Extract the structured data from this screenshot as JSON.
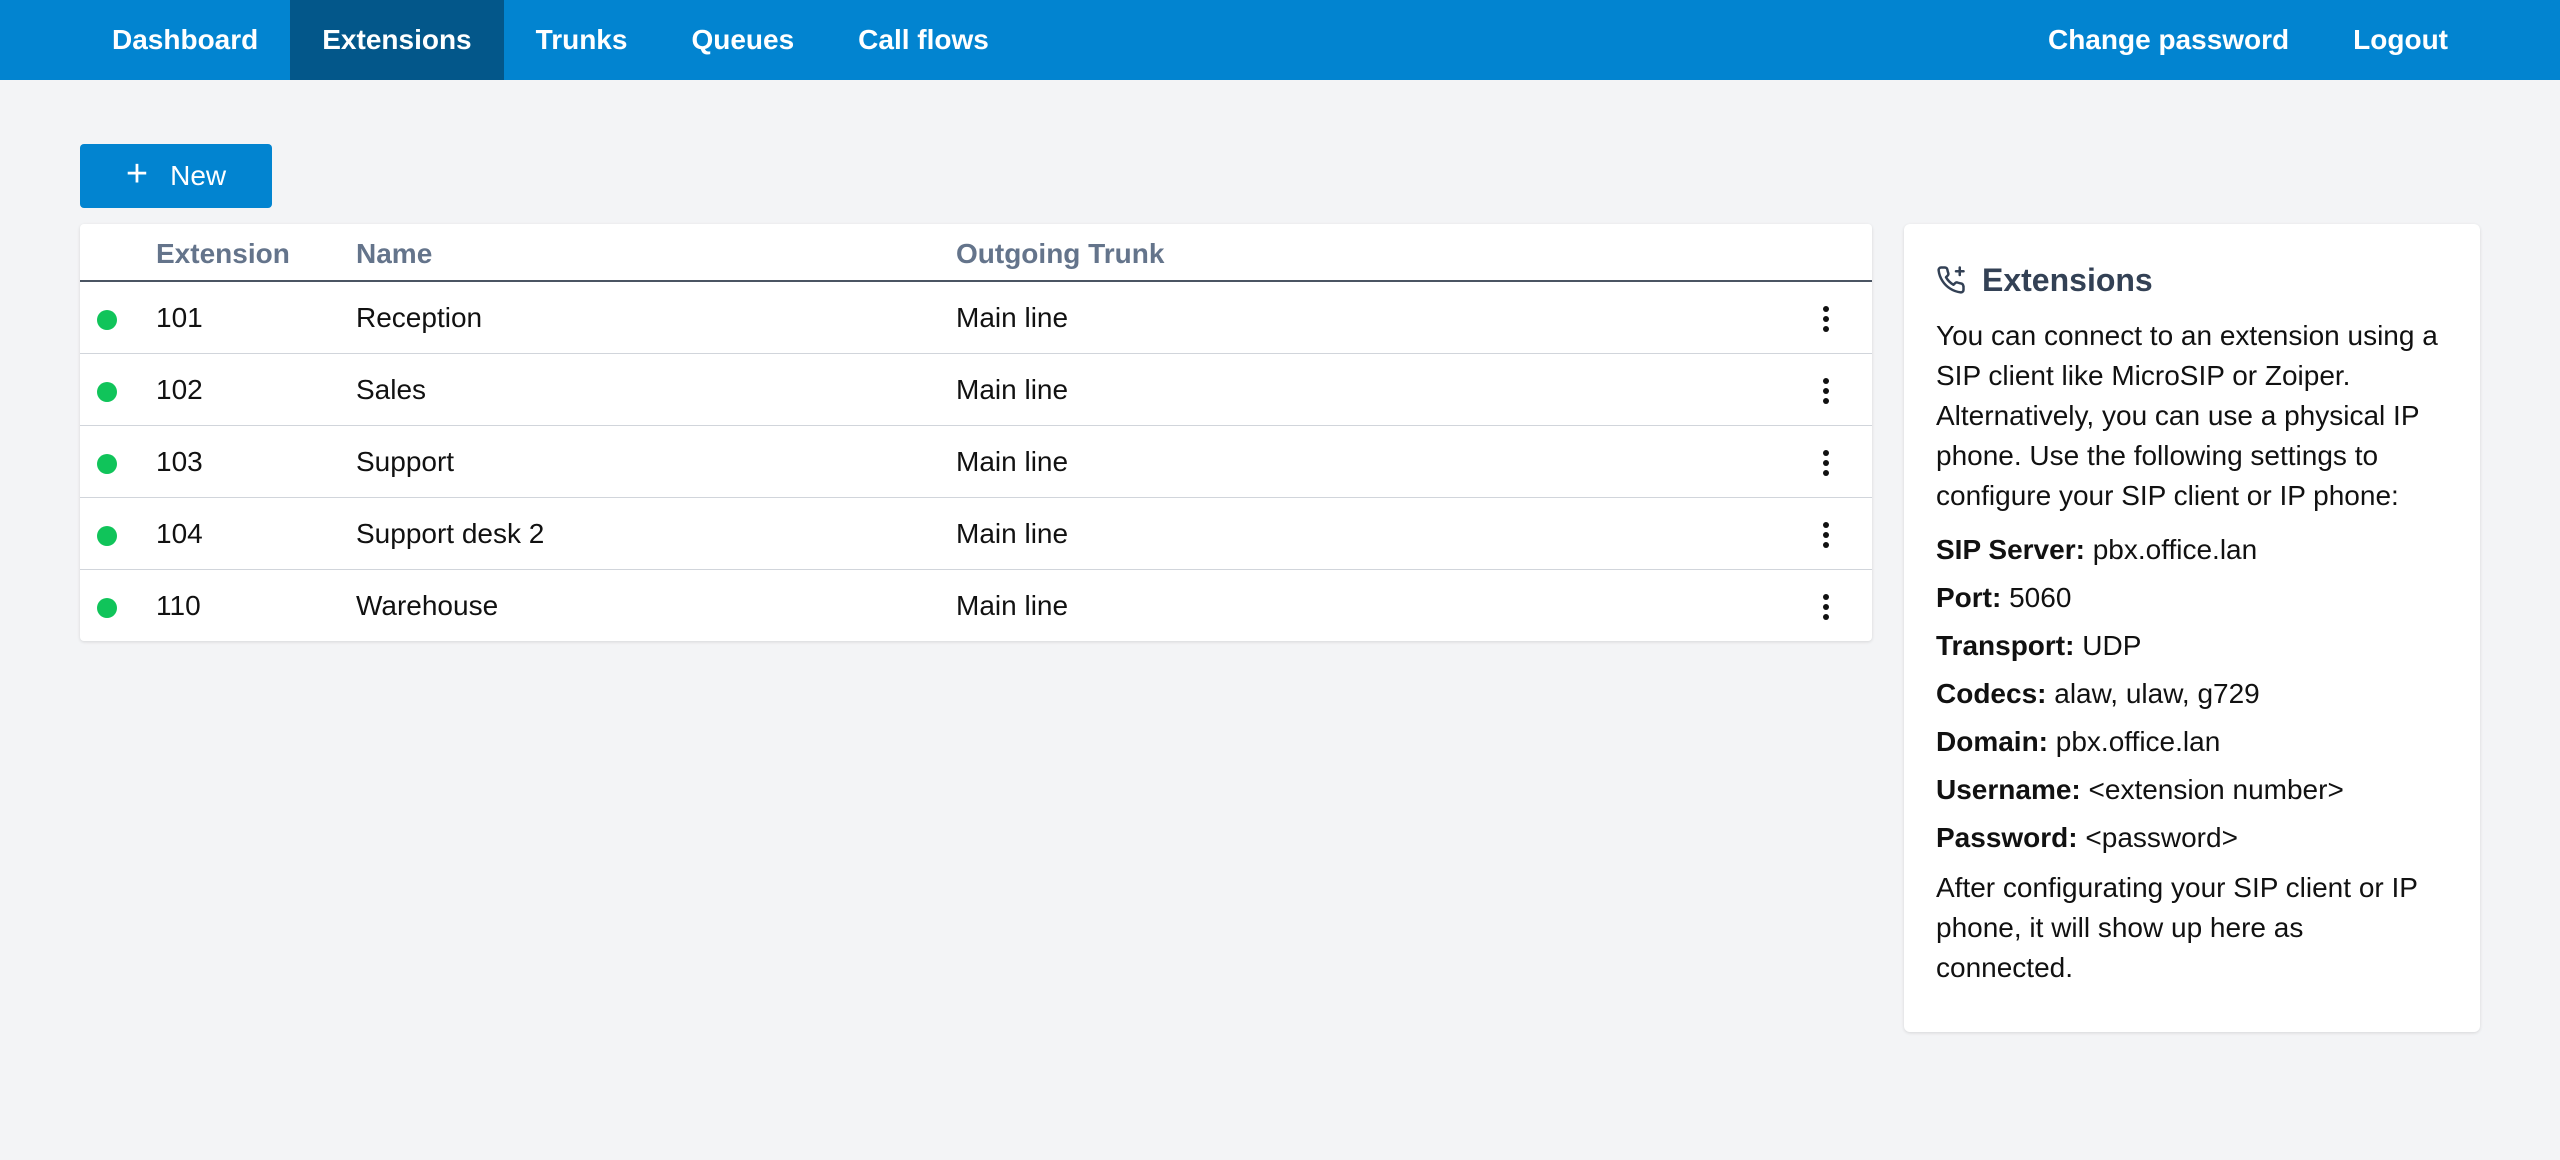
{
  "nav": {
    "left": [
      "Dashboard",
      "Extensions",
      "Trunks",
      "Queues",
      "Call flows"
    ],
    "right": [
      "Change password",
      "Logout"
    ],
    "active": "Extensions",
    "color": "#0284d0",
    "active_color": "#03578a"
  },
  "toolbar": {
    "new_label": "New",
    "new_icon": "plus-icon"
  },
  "table": {
    "headers": {
      "extension": "Extension",
      "name": "Name",
      "trunk": "Outgoing Trunk"
    },
    "rows": [
      {
        "extension": "101",
        "name": "Reception",
        "trunk": "Main line",
        "status": "connected"
      },
      {
        "extension": "102",
        "name": "Sales",
        "trunk": "Main line",
        "status": "connected"
      },
      {
        "extension": "103",
        "name": "Support",
        "trunk": "Main line",
        "status": "connected"
      },
      {
        "extension": "104",
        "name": "Support desk 2",
        "trunk": "Main line",
        "status": "connected"
      },
      {
        "extension": "110",
        "name": "Warehouse",
        "trunk": "Main line",
        "status": "connected"
      }
    ],
    "status_color": "#10c45a"
  },
  "info": {
    "icon": "phone-plus-icon",
    "title": "Extensions",
    "intro": "You can connect to an extension using a SIP client like MicroSIP or Zoiper. Alternatively, you can use a physical IP phone. Use the following settings to configure your SIP client or IP phone:",
    "settings": [
      {
        "label": "SIP Server:",
        "value": "pbx.office.lan"
      },
      {
        "label": "Port:",
        "value": "5060"
      },
      {
        "label": "Transport:",
        "value": "UDP"
      },
      {
        "label": "Codecs:",
        "value": "alaw, ulaw, g729"
      },
      {
        "label": "Domain:",
        "value": "pbx.office.lan"
      },
      {
        "label": "Username:",
        "value": "<extension number>"
      },
      {
        "label": "Password:",
        "value": "<password>"
      }
    ],
    "outro": "After configurating your SIP client or IP phone, it will show up here as connected."
  }
}
